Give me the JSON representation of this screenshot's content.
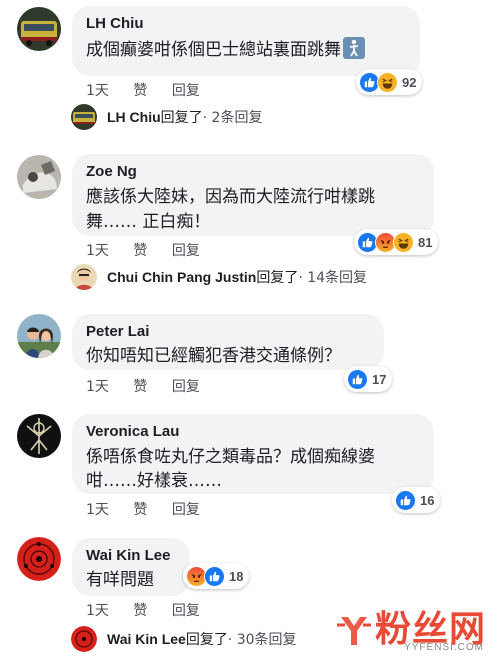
{
  "comments": [
    {
      "name": "LH Chiu",
      "text": "成個癲婆咁係個巴士總站裏面跳舞",
      "time": "1天",
      "like": "赞",
      "reply": "回复",
      "reaction_count": "92",
      "reactions": [
        "like-icon",
        "haha-icon"
      ],
      "replies": {
        "name": "LH Chiu",
        "replied": "回复了",
        "meta": " · 2条回复"
      }
    },
    {
      "name": "Zoe Ng",
      "text_line1": "應該係大陸妹，因為而大陸流行咁樣跳",
      "text_line2": "舞…… 正白痴！",
      "time": "1天",
      "like": "赞",
      "reply": "回复",
      "reaction_count": "81",
      "reactions": [
        "like-icon",
        "angry-icon",
        "haha-icon"
      ],
      "replies": {
        "name": "Chui Chin Pang Justin",
        "replied": "回复了",
        "meta": " · 14条回复"
      }
    },
    {
      "name": "Peter Lai",
      "text": "你知唔知已經觸犯香港交通條例？",
      "time": "1天",
      "like": "赞",
      "reply": "回复",
      "reaction_count": "17",
      "reactions": [
        "like-icon"
      ]
    },
    {
      "name": "Veronica Lau",
      "text_line1": "係唔係食咗丸仔之類毒品？成個痴線婆",
      "text_line2": "咁……好樣衰……",
      "time": "1天",
      "like": "赞",
      "reply": "回复",
      "reaction_count": "16",
      "reactions": [
        "like-icon"
      ]
    },
    {
      "name": "Wai Kin Lee",
      "text": "有咩問題",
      "time": "1天",
      "like": "赞",
      "reply": "回复",
      "reaction_count": "18",
      "reactions": [
        "angry-icon",
        "like-icon"
      ],
      "replies": {
        "name": "Wai Kin Lee",
        "replied": "回复了",
        "meta": " · 30条回复"
      }
    }
  ],
  "watermark": {
    "text": "粉丝网",
    "url": "YYFENSI.COM"
  },
  "colors": {
    "bubble": "#f2f3f5",
    "like_blue": "#1877f2",
    "angry": "#f0483e",
    "haha": "#f7b125",
    "watermark": "#e94a36"
  }
}
